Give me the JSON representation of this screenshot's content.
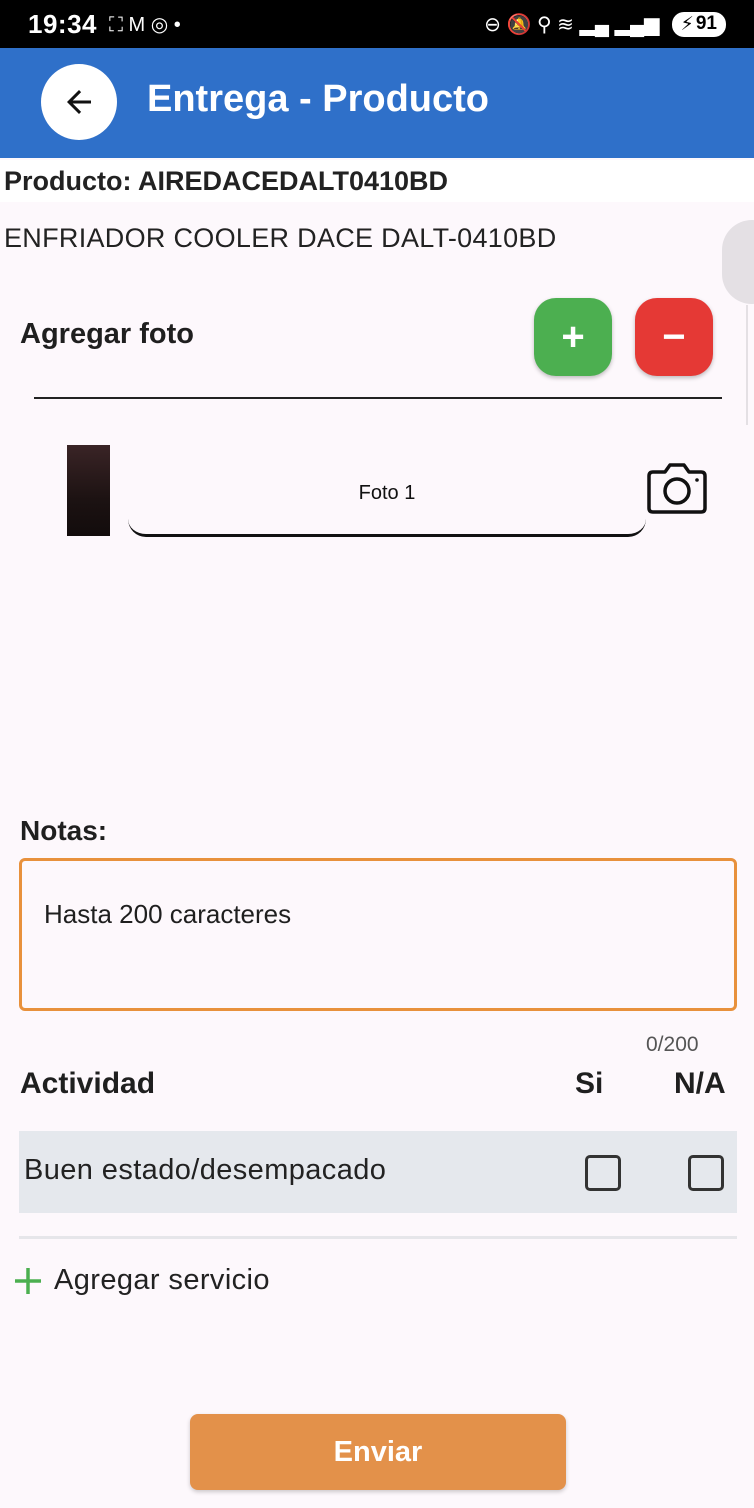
{
  "status_bar": {
    "time": "19:34",
    "left_icons": [
      "screenshot-icon",
      "gmail-icon",
      "instagram-icon",
      "dot-icon"
    ],
    "left_glyphs": "⛶ M ◎ •",
    "right_glyphs": "⊖ 🔕 ⚲ ≋ ▂▄ ▂▄▆",
    "battery": "91"
  },
  "app_bar": {
    "title": "Entrega - Producto",
    "color": "#2f70c9"
  },
  "product": {
    "code_line": "Producto: AIREDACEDALT0410BD",
    "description": "ENFRIADOR  COOLER DACE DALT-0410BD"
  },
  "photos": {
    "section_label": "Agregar foto",
    "add_label": "+",
    "remove_label": "−",
    "items": [
      {
        "label": "Foto 1"
      }
    ]
  },
  "notes": {
    "label": "Notas:",
    "placeholder": "Hasta 200 caracteres",
    "counter": "0/200",
    "border_color": "#e8913c"
  },
  "activities": {
    "header": "Actividad",
    "col_si": "Si",
    "col_na": "N/A",
    "rows": [
      {
        "label": "Buen estado/desempacado",
        "si": false,
        "na": false
      }
    ]
  },
  "add_service": {
    "label": "Agregar servicio"
  },
  "submit": {
    "label": "Enviar",
    "color": "#e3914a"
  }
}
